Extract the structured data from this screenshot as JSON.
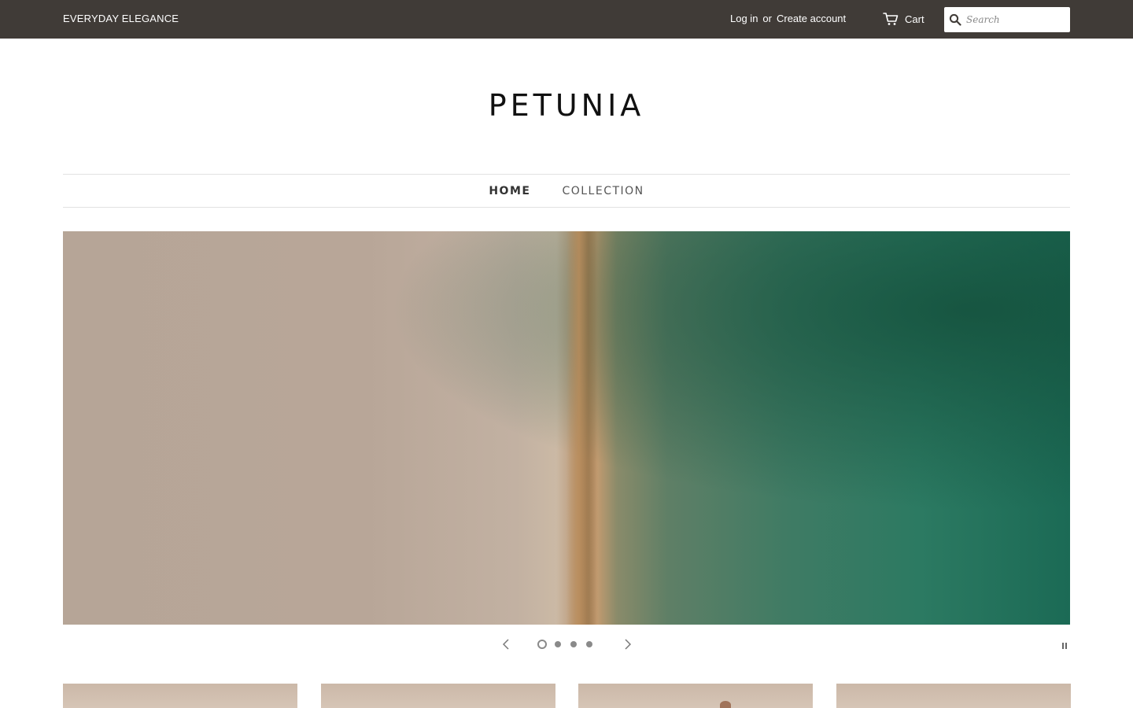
{
  "topbar": {
    "tagline": "EVERYDAY ELEGANCE",
    "login_label": "Log in",
    "or_text": "or",
    "create_account_label": "Create account",
    "cart_label": "Cart",
    "search_placeholder": "Search",
    "background_color": "#403b37"
  },
  "logo": {
    "text": "PETUNIA"
  },
  "nav": {
    "items": [
      {
        "label": "HOME",
        "active": true
      },
      {
        "label": "COLLECTION",
        "active": false
      }
    ]
  },
  "slideshow": {
    "slide_count": 4,
    "active_slide": 1,
    "paused": false
  },
  "products": {
    "visible_count": 4
  }
}
